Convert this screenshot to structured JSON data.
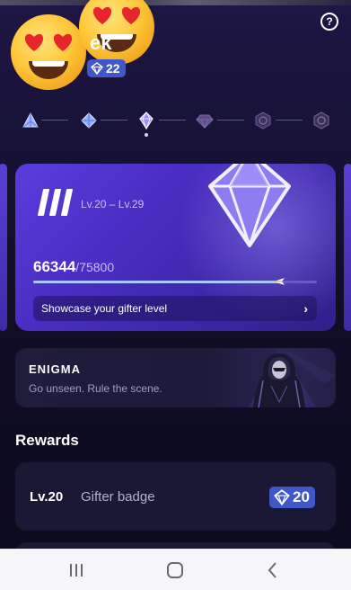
{
  "header": {
    "username": "ek",
    "level_badge": "22",
    "help_icon": "help-circle-icon"
  },
  "level_track": {
    "nodes": [
      "triangle-gem-icon",
      "diamond-gem-icon",
      "octahedron-gem-icon",
      "dark-gem-icon",
      "hexagon-gem-icon",
      "hexagon-gem-icon"
    ],
    "current_index": 2
  },
  "tier_card": {
    "tier_numeral": "III",
    "level_range": "Lv.20 – Lv.29",
    "points_current": "66344",
    "points_total": "/75800",
    "progress": 0.875,
    "showcase_label": "Showcase your gifter level",
    "chevron": "›"
  },
  "enigma": {
    "title": "ENIGMA",
    "subtitle": "Go unseen. Rule the scene."
  },
  "rewards": {
    "title": "Rewards",
    "items": [
      {
        "level": "Lv.20",
        "name": "Gifter badge",
        "badge_value": "20"
      }
    ]
  },
  "nav": {
    "recents": "recents-icon",
    "home": "home-icon",
    "back": "back-icon"
  },
  "colors": {
    "accent": "#3f57c9",
    "card": "#4a2ec4",
    "background": "#100d26"
  }
}
